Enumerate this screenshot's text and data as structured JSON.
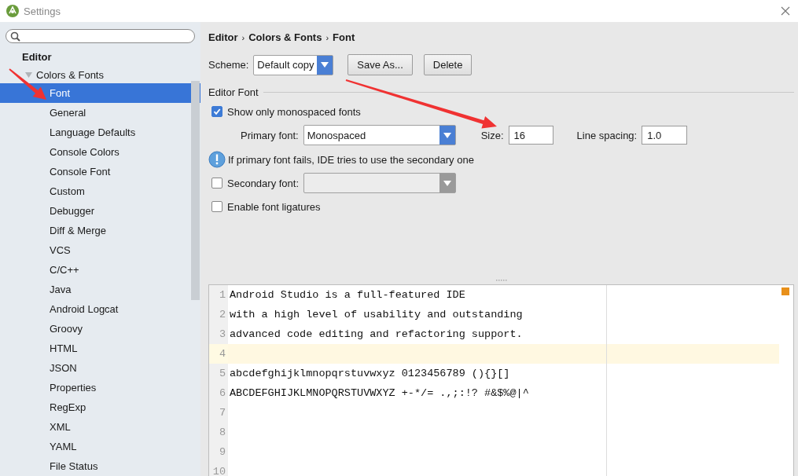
{
  "window": {
    "title": "Settings"
  },
  "sidebar": {
    "tree": [
      {
        "label": "Editor",
        "kind": "header",
        "children": [
          {
            "label": "Colors & Fonts",
            "kind": "node",
            "expanded": true,
            "selected": false,
            "children": [
              {
                "label": "Font",
                "selected": true
              },
              {
                "label": "General",
                "selected": false
              },
              {
                "label": "Language Defaults",
                "selected": false
              },
              {
                "label": "Console Colors",
                "selected": false
              },
              {
                "label": "Console Font",
                "selected": false
              },
              {
                "label": "Custom",
                "selected": false
              },
              {
                "label": "Debugger",
                "selected": false
              },
              {
                "label": "Diff & Merge",
                "selected": false
              },
              {
                "label": "VCS",
                "selected": false
              },
              {
                "label": "C/C++",
                "selected": false
              },
              {
                "label": "Java",
                "selected": false
              },
              {
                "label": "Android Logcat",
                "selected": false
              },
              {
                "label": "Groovy",
                "selected": false
              },
              {
                "label": "HTML",
                "selected": false
              },
              {
                "label": "JSON",
                "selected": false
              },
              {
                "label": "Properties",
                "selected": false
              },
              {
                "label": "RegExp",
                "selected": false
              },
              {
                "label": "XML",
                "selected": false
              },
              {
                "label": "YAML",
                "selected": false
              },
              {
                "label": "File Status",
                "selected": false
              }
            ]
          }
        ]
      }
    ]
  },
  "breadcrumb": [
    {
      "kind": "crumb",
      "text": "Editor"
    },
    {
      "kind": "separator",
      "text": "›"
    },
    {
      "kind": "crumb",
      "text": "Colors & Fonts"
    },
    {
      "kind": "separator",
      "text": "›"
    },
    {
      "kind": "crumb",
      "text": "Font"
    }
  ],
  "scheme": {
    "label": "Scheme:",
    "value": "Default copy",
    "buttons": [
      "Save As...",
      "Delete"
    ]
  },
  "editor_font": {
    "section": "Editor Font",
    "show_monospaced": {
      "label": "Show only monospaced fonts",
      "checked": true
    },
    "primary_font": {
      "label": "Primary font:",
      "value": "Monospaced"
    },
    "size": {
      "label": "Size:",
      "value": "16"
    },
    "line_spacing": {
      "label": "Line spacing:",
      "value": "1.0"
    },
    "info": "If primary font fails, IDE tries to use the secondary one",
    "secondary_font": {
      "label": "Secondary font:",
      "checked": false,
      "disabled": true
    },
    "ligatures": {
      "label": "Enable font ligatures",
      "checked": false
    }
  },
  "preview": {
    "lines": [
      {
        "number": "1",
        "text": "Android Studio is a full-featured IDE",
        "current": false
      },
      {
        "number": "2",
        "text": "with a high level of usability and outstanding",
        "current": false
      },
      {
        "number": "3",
        "text": "advanced code editing and refactoring support.",
        "current": false
      },
      {
        "number": "4",
        "current": true
      },
      {
        "number": "5",
        "text": "abcdefghijklmnopqrstuvwxyz 0123456789 (){}[]",
        "current": false
      },
      {
        "number": "6",
        "text": "ABCDEFGHIJKLMNOPQRSTUVWXYZ +-*/= .,;:!? #&$%@|^",
        "current": false
      },
      {
        "number": "7",
        "current": false
      },
      {
        "number": "8",
        "current": false
      },
      {
        "number": "9",
        "current": false
      },
      {
        "number": "10",
        "current": false
      }
    ]
  }
}
